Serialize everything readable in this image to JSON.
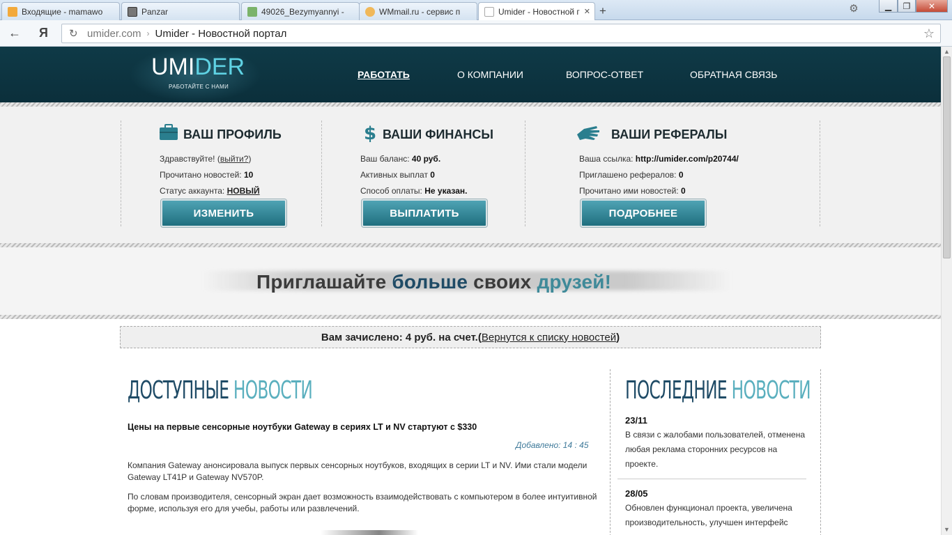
{
  "browser": {
    "tabs": [
      {
        "label": "Входящие - mamawo"
      },
      {
        "label": "Panzar"
      },
      {
        "label": "49026_Bezymyannyi -"
      },
      {
        "label": "WMmail.ru - сервис п"
      },
      {
        "label": "Umider - Новостной г"
      }
    ],
    "new_tab": "+",
    "address": {
      "host": "umider.com",
      "separator": "›",
      "title": "Umider - Новостной портал"
    },
    "yandex": "Я"
  },
  "header": {
    "logo_umi": "UMI",
    "logo_der": "DER",
    "tagline": "РАБОТАЙТЕ С НАМИ",
    "nav": [
      "РАБОТАТЬ",
      "О КОМПАНИИ",
      "ВОПРОС-ОТВЕТ",
      "ОБРАТНАЯ СВЯЗЬ"
    ]
  },
  "profile": {
    "title": "ВАШ ПРОФИЛЬ",
    "greeting": "Здравствуйте! (",
    "logout": "выйти?",
    "greeting_end": ")",
    "read_label": "Прочитано новостей: ",
    "read_value": "10",
    "status_label": "Статус аккаунта: ",
    "status_value": "НОВЫЙ",
    "button": "ИЗМЕНИТЬ"
  },
  "finance": {
    "title": "ВАШИ ФИНАНСЫ",
    "balance_label": "Ваш баланс: ",
    "balance_value": "40 руб.",
    "payouts_label": "Активных выплат ",
    "payouts_value": "0",
    "method_label": "Способ оплаты: ",
    "method_value": "Не указан.",
    "button": "ВЫПЛАТИТЬ"
  },
  "referrals": {
    "title": "ВАШИ РЕФЕРАЛЫ",
    "link_label": "Ваша ссылка: ",
    "link_value": "http://umider.com/p20744/",
    "invited_label": "Приглашено рефералов: ",
    "invited_value": "0",
    "read_label": "Прочитано ими новостей: ",
    "read_value": "0",
    "button": "ПОДРОБНЕЕ"
  },
  "banner": {
    "part1": "Приглашайте ",
    "part2": "больше",
    "part3": " своих ",
    "part4": "друзей!"
  },
  "notice": {
    "text": "Вам зачислено: 4 руб. на счет.(",
    "link": "Вернутся к списку новостей",
    "end": ")"
  },
  "news": {
    "heading_dark": "ДОСТУПНЫЕ",
    "heading_light": "НОВОСТИ",
    "title": "Цены на первые сенсорные ноутбуки Gateway в сериях LT и NV стартуют с $330",
    "added": "Добавлено: 14 : 45",
    "p1": "Компания Gateway анонсировала выпуск первых сенсорных ноутбуков, входящих в серии LT и NV. Ими стали модели Gateway LT41P и Gateway NV570P.",
    "p2": "По словам производителя, сенсорный экран дает возможность взаимодействовать с компьютером в более интуитивной форме, используя его для учебы, работы или развлечений."
  },
  "sidebar": {
    "heading_dark": "ПОСЛЕДНИЕ",
    "heading_light": "НОВОСТИ",
    "items": [
      {
        "date": "23/11",
        "text": "В связи с жалобами пользователей, отменена любая реклама сторонних ресурсов на проекте."
      },
      {
        "date": "28/05",
        "text": "Обновлен функционал проекта, увеличена производительность, улучшен интерфейс"
      }
    ]
  },
  "colors": {
    "header_bg": "#0f3a47",
    "accent_cyan": "#5fd2e3",
    "button_teal": "#2a7e8e",
    "heading_dark": "#1f4b66",
    "heading_light": "#5aafbe"
  }
}
